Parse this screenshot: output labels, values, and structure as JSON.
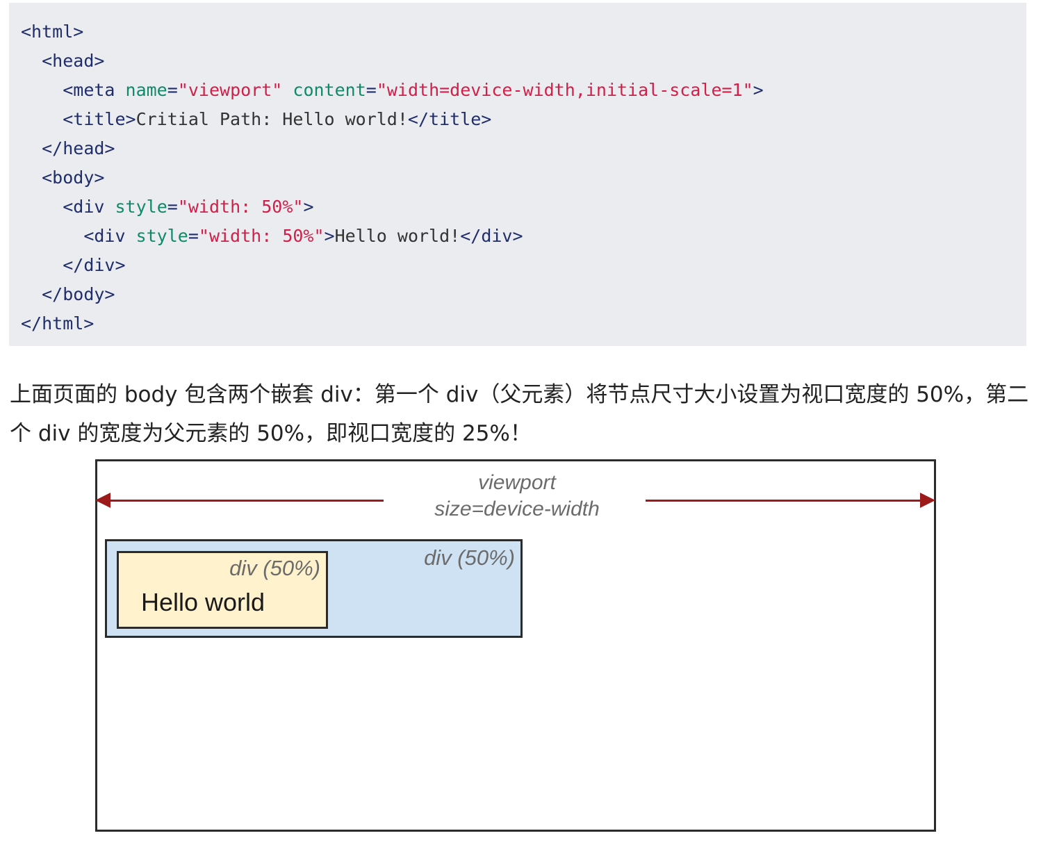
{
  "code": {
    "lines": [
      {
        "indent": "",
        "parts": [
          {
            "t": "tag",
            "v": "<html>"
          }
        ]
      },
      {
        "indent": "  ",
        "parts": [
          {
            "t": "tag",
            "v": "<head>"
          }
        ]
      },
      {
        "indent": "    ",
        "parts": [
          {
            "t": "tag",
            "v": "<meta "
          },
          {
            "t": "attr",
            "v": "name"
          },
          {
            "t": "tag",
            "v": "="
          },
          {
            "t": "str",
            "v": "\"viewport\""
          },
          {
            "t": "tag",
            "v": " "
          },
          {
            "t": "attr",
            "v": "content"
          },
          {
            "t": "tag",
            "v": "="
          },
          {
            "t": "str",
            "v": "\"width=device-width,initial-scale=1\""
          },
          {
            "t": "tag",
            "v": ">"
          }
        ]
      },
      {
        "indent": "    ",
        "parts": [
          {
            "t": "tag",
            "v": "<title>"
          },
          {
            "t": "txt",
            "v": "Critial Path: Hello world!"
          },
          {
            "t": "tag",
            "v": "</title>"
          }
        ]
      },
      {
        "indent": "  ",
        "parts": [
          {
            "t": "tag",
            "v": "</head>"
          }
        ]
      },
      {
        "indent": "  ",
        "parts": [
          {
            "t": "tag",
            "v": "<body>"
          }
        ]
      },
      {
        "indent": "    ",
        "parts": [
          {
            "t": "tag",
            "v": "<div "
          },
          {
            "t": "attr",
            "v": "style"
          },
          {
            "t": "tag",
            "v": "="
          },
          {
            "t": "str",
            "v": "\"width: 50%\""
          },
          {
            "t": "tag",
            "v": ">"
          }
        ]
      },
      {
        "indent": "      ",
        "parts": [
          {
            "t": "tag",
            "v": "<div "
          },
          {
            "t": "attr",
            "v": "style"
          },
          {
            "t": "tag",
            "v": "="
          },
          {
            "t": "str",
            "v": "\"width: 50%\""
          },
          {
            "t": "tag",
            "v": ">"
          },
          {
            "t": "txt",
            "v": "Hello world!"
          },
          {
            "t": "tag",
            "v": "</div>"
          }
        ]
      },
      {
        "indent": "    ",
        "parts": [
          {
            "t": "tag",
            "v": "</div>"
          }
        ]
      },
      {
        "indent": "  ",
        "parts": [
          {
            "t": "tag",
            "v": "</body>"
          }
        ]
      },
      {
        "indent": "",
        "parts": [
          {
            "t": "tag",
            "v": "</html>"
          }
        ]
      }
    ]
  },
  "paragraph": "上面页面的 body 包含两个嵌套 div：第一个 div（父元素）将节点尺寸大小设置为视口宽度的 50%，第二个 div 的宽度为父元素的 50%，即视口宽度的 25%！",
  "diagram": {
    "viewport_label_line1": "viewport",
    "viewport_label_line2": "size=device-width",
    "outer_div_label": "div (50%)",
    "inner_div_label": "div (50%)",
    "inner_text": "Hello world",
    "colors": {
      "arrow": "#9c1a1a",
      "outer_fill": "#cfe2f3",
      "inner_fill": "#fff2cc",
      "code_bg": "#ebecf0"
    }
  }
}
